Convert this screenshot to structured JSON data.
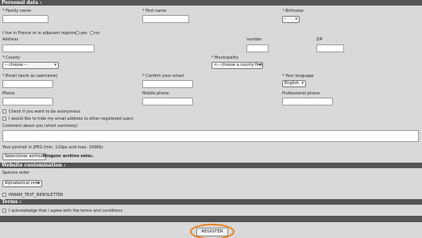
{
  "sections": {
    "personal": "Personal data :",
    "website": "Website customisation :",
    "terms": "Terms :"
  },
  "personal": {
    "family_name_label": "* Family name",
    "first_name_label": "* First name",
    "birthyear_label": "* Birthyear",
    "birthyear_value": "-",
    "residence_label": "I live in France or in adjacent regions :",
    "residence_yes": "yes",
    "residence_no": "no",
    "address_label": "Address",
    "number_label": "number",
    "zip_label": "ZIP",
    "county_label": "* County",
    "county_value": "-- choose --",
    "municipality_label": "* Municipality",
    "municipality_value": "<-- choose a county first",
    "email_label": "* Email (work as username)",
    "confirm_email_label": "* Confirm your email",
    "language_label": "* Your language",
    "language_value": "English",
    "phone_label": "Phone",
    "mobile_label": "Mobile phone",
    "pro_phone_label": "Professional phone",
    "anonymous_label": "Check if you want to be anonymous",
    "hide_email_label": "I would like to hide my email address to other registered users",
    "comment_label": "Comment about you (short summary)",
    "portrait_label": "Your portrait in JPEG (min. 120px and max. 100Kb)",
    "file_button": "Seleccionar archivo",
    "file_status": "Ningunc archivo selec."
  },
  "website": {
    "species_order_label": "Species order",
    "species_order_value": "Alphabetical orde",
    "newsletter_label": "PARAM_TEXT_NEWSLETTER"
  },
  "terms": {
    "agree_label": "I acknowledge that I agree with the terms and conditions"
  },
  "register_button": "REGISTER",
  "colors": {
    "section_bar": "#555555",
    "page_bg": "#d9d9d9",
    "highlight_ring": "#e8821e"
  }
}
